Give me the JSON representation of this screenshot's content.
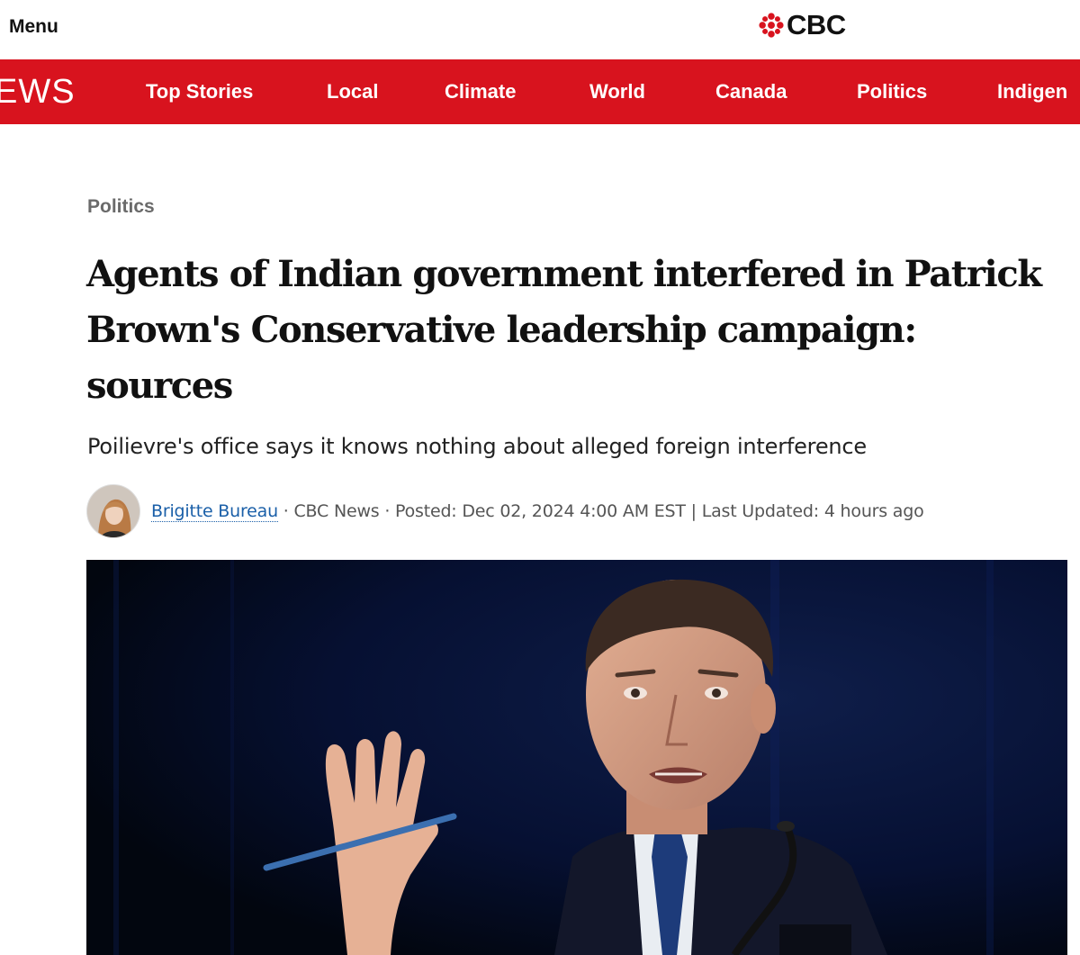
{
  "header": {
    "menu_label": "Menu",
    "logo_text": "CBC"
  },
  "nav": {
    "brand_partial": "EWS",
    "items": [
      {
        "label": "Top Stories"
      },
      {
        "label": "Local"
      },
      {
        "label": "Climate"
      },
      {
        "label": "World"
      },
      {
        "label": "Canada"
      },
      {
        "label": "Politics"
      },
      {
        "label": "Indigen"
      }
    ]
  },
  "article": {
    "section": "Politics",
    "headline": "Agents of Indian government interfered in Patrick Brown's Conservative leadership campaign: sources",
    "deck": "Poilievre's office says it knows nothing about alleged foreign interference",
    "author": "Brigitte Bureau",
    "byline_rest": " · CBC News · Posted: Dec 02, 2024 4:00 AM EST | Last Updated: 4 hours ago"
  },
  "colors": {
    "brand_red": "#d8131e",
    "link_blue": "#1a5fa8"
  }
}
